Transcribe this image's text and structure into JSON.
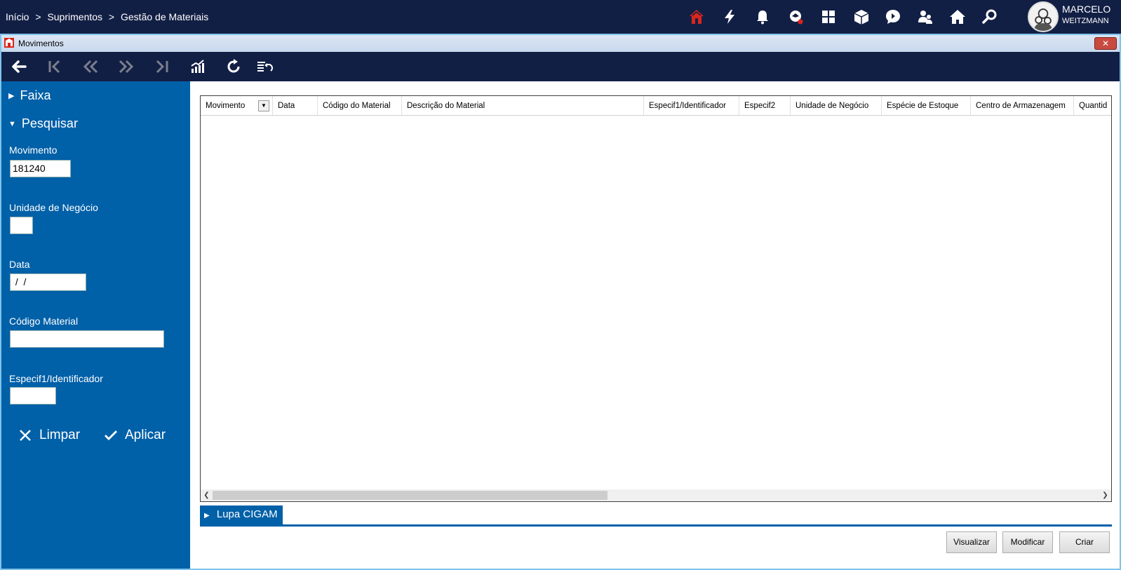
{
  "breadcrumb": {
    "items": [
      "Início",
      "Suprimentos",
      "Gestão de Materiais"
    ],
    "separator": ">"
  },
  "top_icons": [
    "company-logo-icon",
    "lightning-icon",
    "bell-icon",
    "support-icon",
    "grid-icon",
    "box-icon",
    "chat-icon",
    "users-icon",
    "home-icon",
    "search-icon"
  ],
  "user": {
    "first_name": "MARCELO",
    "last_name": "WEITZMANN"
  },
  "window": {
    "title": "Movimentos",
    "close_label": "✕"
  },
  "toolbar": {
    "buttons": [
      "back-icon",
      "first-icon",
      "previous-icon",
      "next-icon",
      "last-icon",
      "chart-icon",
      "refresh-icon",
      "undo-list-icon"
    ]
  },
  "sidebar": {
    "faixa_label": "Faixa",
    "pesquisar_label": "Pesquisar",
    "fields": {
      "movimento": {
        "label": "Movimento",
        "value": "181240"
      },
      "unidade": {
        "label": "Unidade de Negócio",
        "value": ""
      },
      "data": {
        "label": "Data",
        "value": " /  /"
      },
      "codigo": {
        "label": "Código Material",
        "value": ""
      },
      "especif": {
        "label": "Especif1/Identificador",
        "value": ""
      }
    },
    "limpar_label": "Limpar",
    "aplicar_label": "Aplicar"
  },
  "grid": {
    "columns": [
      "Movimento",
      "Data",
      "Código do Material",
      "Descrição do Material",
      "Especif1/Identificador",
      "Especif2",
      "Unidade de Negócio",
      "Espécie de Estoque",
      "Centro de Armazenagem",
      "Quantid"
    ],
    "rows": []
  },
  "lupa": {
    "label": "Lupa CIGAM"
  },
  "buttons": {
    "visualizar": "Visualizar",
    "modificar": "Modificar",
    "criar": "Criar"
  },
  "colors": {
    "topbar": "#121f45",
    "panel": "#0060a8",
    "accent_red": "#d9261c"
  }
}
